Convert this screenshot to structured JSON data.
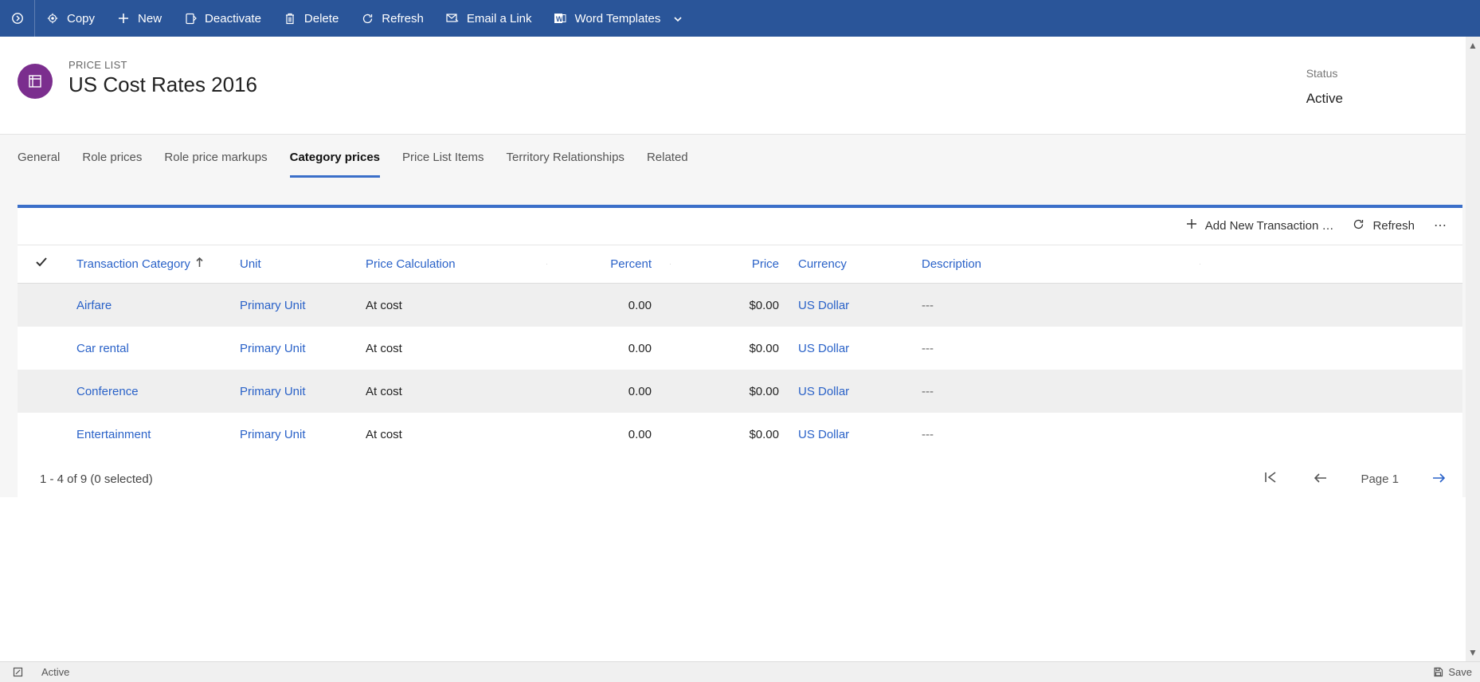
{
  "commandBar": {
    "copy": "Copy",
    "new": "New",
    "deactivate": "Deactivate",
    "delete": "Delete",
    "refresh": "Refresh",
    "emailLink": "Email a Link",
    "wordTemplates": "Word Templates"
  },
  "record": {
    "eyebrow": "PRICE LIST",
    "title": "US Cost Rates 2016",
    "statusLabel": "Status",
    "statusValue": "Active"
  },
  "tabs": {
    "general": "General",
    "rolePrices": "Role prices",
    "rolePriceMarkups": "Role price markups",
    "categoryPrices": "Category prices",
    "priceListItems": "Price List Items",
    "territory": "Territory Relationships",
    "related": "Related"
  },
  "gridBar": {
    "addNew": "Add New Transaction …",
    "refresh": "Refresh"
  },
  "columns": {
    "transactionCategory": "Transaction Category",
    "unit": "Unit",
    "priceCalc": "Price Calculation",
    "percent": "Percent",
    "price": "Price",
    "currency": "Currency",
    "description": "Description"
  },
  "rows": [
    {
      "cat": "Airfare",
      "unit": "Primary Unit",
      "calc": "At cost",
      "pct": "0.00",
      "price": "$0.00",
      "curr": "US Dollar",
      "desc": "---"
    },
    {
      "cat": "Car rental",
      "unit": "Primary Unit",
      "calc": "At cost",
      "pct": "0.00",
      "price": "$0.00",
      "curr": "US Dollar",
      "desc": "---"
    },
    {
      "cat": "Conference",
      "unit": "Primary Unit",
      "calc": "At cost",
      "pct": "0.00",
      "price": "$0.00",
      "curr": "US Dollar",
      "desc": "---"
    },
    {
      "cat": "Entertainment",
      "unit": "Primary Unit",
      "calc": "At cost",
      "pct": "0.00",
      "price": "$0.00",
      "curr": "US Dollar",
      "desc": "---"
    }
  ],
  "footer": {
    "countText": "1 - 4 of 9 (0 selected)",
    "pageLabel": "Page 1"
  },
  "statusBar": {
    "state": "Active",
    "save": "Save"
  }
}
